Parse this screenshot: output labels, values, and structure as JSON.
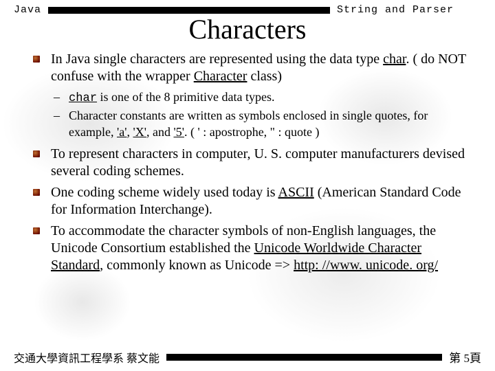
{
  "header": {
    "left": "Java",
    "right": "String and Parser"
  },
  "title": "Characters",
  "bullets": [
    {
      "pre": "In Java single characters are represented using the data type ",
      "u1": "char",
      "mid": ". ( do NOT confuse with the wrapper ",
      "u2": "Character",
      "post": " class)"
    },
    {
      "text": "To represent characters in computer, U. S. computer manufacturers devised several coding schemes."
    },
    {
      "pre": "One coding scheme widely used today is ",
      "u1": "ASCII",
      "post": " (American Standard Code for Information Interchange)."
    },
    {
      "pre": "To accommodate the character symbols of non-English languages, the Unicode Consortium established the ",
      "u1": "Unicode Worldwide Character Standard",
      "mid": ", commonly known as Unicode =>    ",
      "link": "http: //www. unicode. org/"
    }
  ],
  "subs": [
    {
      "u1": "char",
      "post": " is one of the 8 primitive data types."
    },
    {
      "pre": "Character constants are written as symbols enclosed in single quotes, for example, ",
      "u1": "'a'",
      "mid1": ", ",
      "u2": "'X'",
      "mid2": ", and ",
      "u3": "'5'",
      "post": ".  (  ' : apostrophe,    \" : quote )"
    }
  ],
  "footer": {
    "left": "交通大學資訊工程學系  蔡文能",
    "right": "第 5頁"
  }
}
